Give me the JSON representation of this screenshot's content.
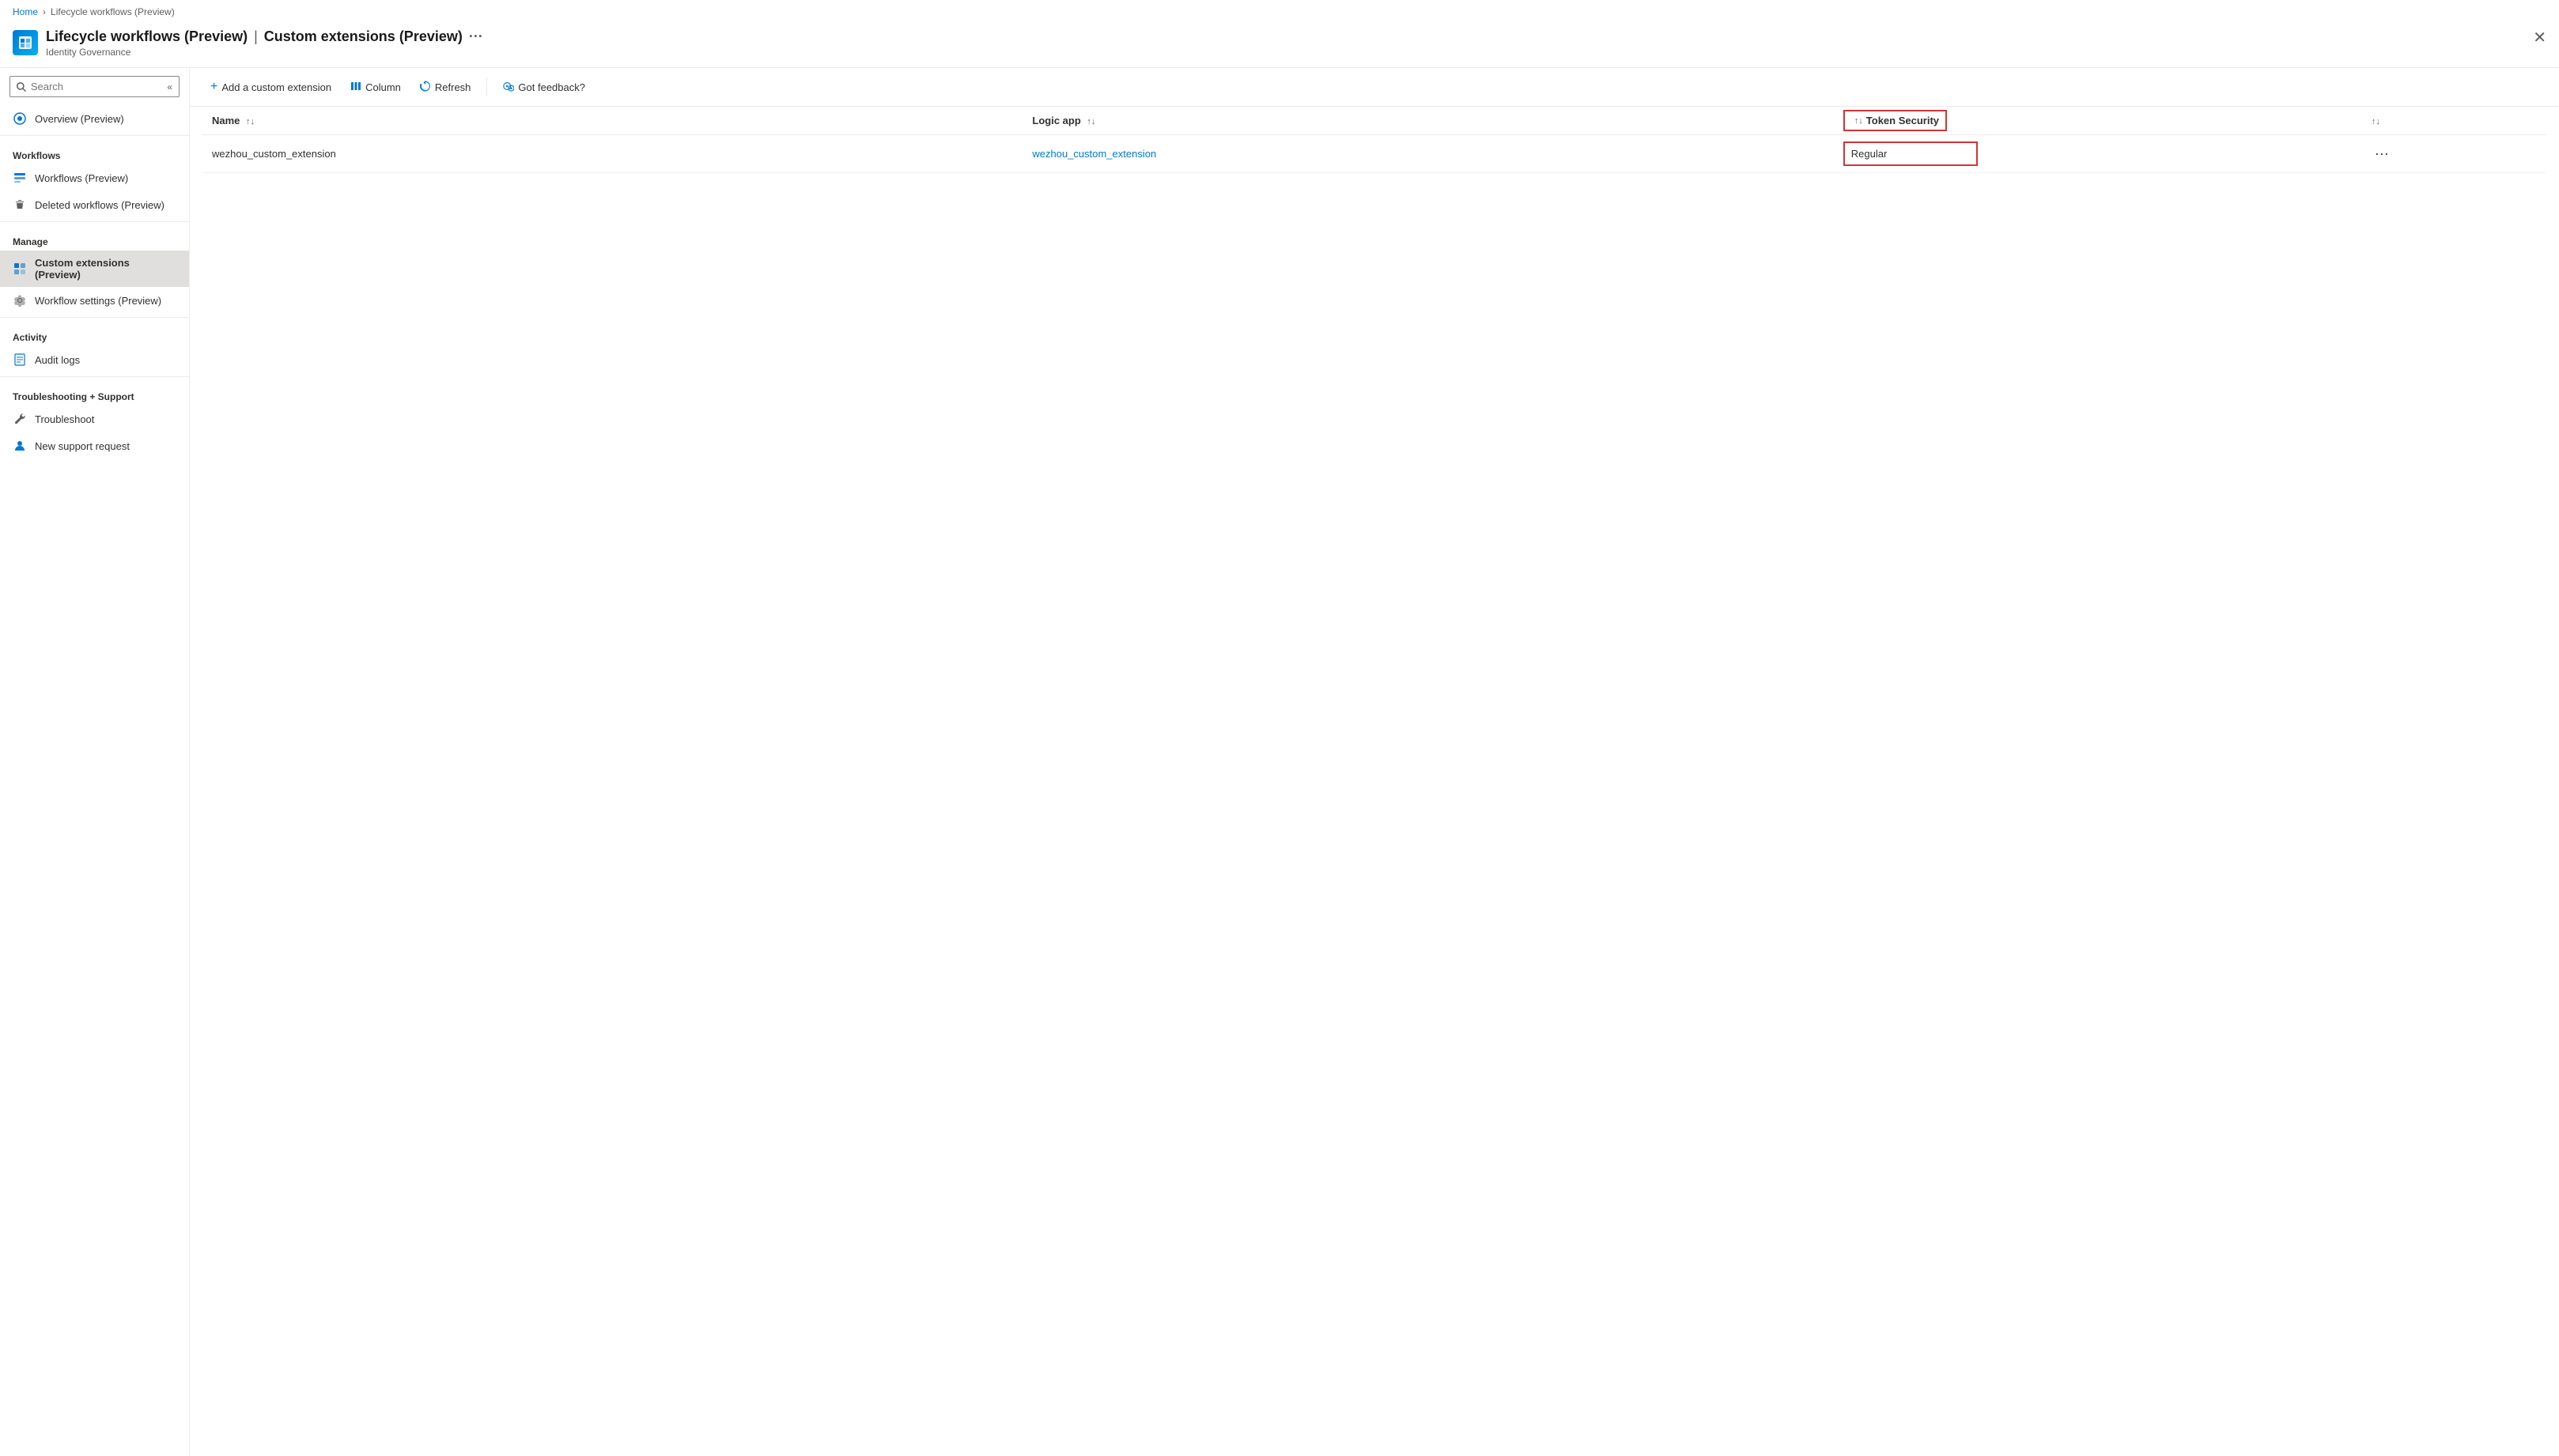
{
  "breadcrumb": {
    "home": "Home",
    "current": "Lifecycle workflows (Preview)"
  },
  "header": {
    "title": "Lifecycle workflows (Preview)",
    "separator": "|",
    "subtitle_page": "Custom extensions (Preview)",
    "subtitle": "Identity Governance",
    "dots": "···",
    "close": "✕"
  },
  "sidebar": {
    "search_placeholder": "Search",
    "collapse_icon": "«",
    "items": [
      {
        "id": "overview",
        "label": "Overview (Preview)",
        "icon": "overview"
      }
    ],
    "sections": [
      {
        "label": "Workflows",
        "items": [
          {
            "id": "workflows",
            "label": "Workflows (Preview)",
            "icon": "workflow"
          },
          {
            "id": "deleted-workflows",
            "label": "Deleted workflows (Preview)",
            "icon": "trash"
          }
        ]
      },
      {
        "label": "Manage",
        "items": [
          {
            "id": "custom-extensions",
            "label": "Custom extensions (Preview)",
            "icon": "extension",
            "active": true
          },
          {
            "id": "workflow-settings",
            "label": "Workflow settings (Preview)",
            "icon": "gear"
          }
        ]
      },
      {
        "label": "Activity",
        "items": [
          {
            "id": "audit-logs",
            "label": "Audit logs",
            "icon": "audit"
          }
        ]
      },
      {
        "label": "Troubleshooting + Support",
        "items": [
          {
            "id": "troubleshoot",
            "label": "Troubleshoot",
            "icon": "wrench"
          },
          {
            "id": "new-support",
            "label": "New support request",
            "icon": "support"
          }
        ]
      }
    ]
  },
  "toolbar": {
    "add_label": "Add a custom extension",
    "column_label": "Column",
    "refresh_label": "Refresh",
    "feedback_label": "Got feedback?"
  },
  "table": {
    "columns": [
      {
        "id": "name",
        "label": "Name",
        "sortable": true
      },
      {
        "id": "logic-app",
        "label": "Logic app",
        "sortable": true
      },
      {
        "id": "token-security",
        "label": "Token Security",
        "sortable": true,
        "highlighted": true
      },
      {
        "id": "actions",
        "label": "",
        "sortable": false
      }
    ],
    "rows": [
      {
        "name": "wezhou_custom_extension",
        "logic_app": "wezhou_custom_extension",
        "logic_app_link": "#",
        "token_security": "Regular"
      }
    ]
  }
}
